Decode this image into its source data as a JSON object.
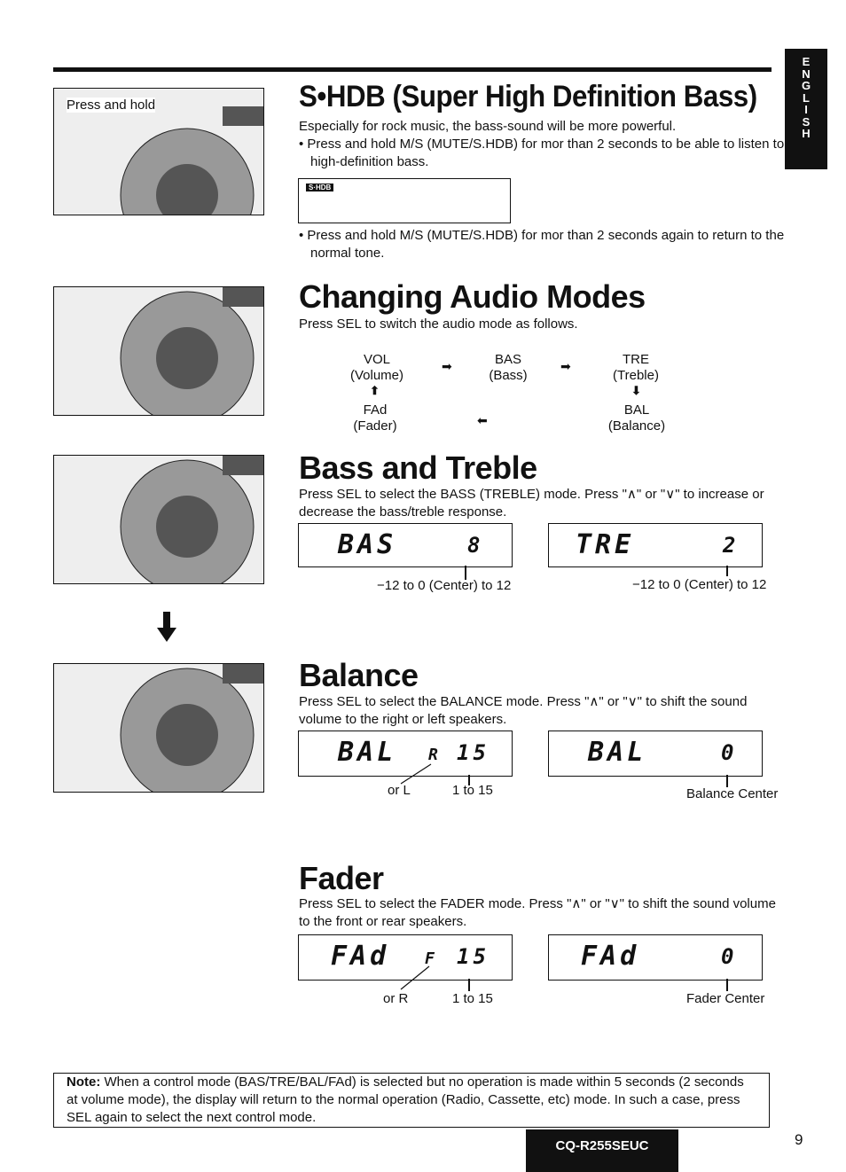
{
  "language_tab": [
    "E",
    "N",
    "G",
    "L",
    "I",
    "S",
    "H"
  ],
  "shdb": {
    "image_caption": "Press and hold",
    "title": "S•HDB (Super High Definition Bass)",
    "intro": "Especially for rock music, the bass-sound will be more powerful.",
    "bullet1": "Press and hold M/S (MUTE/S.HDB) for mor than 2 seconds to be able to listen to high-definition bass.",
    "display_indicator": "S·HDB",
    "bullet2": "Press and hold M/S (MUTE/S.HDB) for mor than 2 seconds again to return to the normal tone."
  },
  "audio_modes": {
    "title": "Changing Audio Modes",
    "intro": "Press SEL to switch the audio mode as follows.",
    "modes": [
      {
        "code": "VOL",
        "name": "(Volume)"
      },
      {
        "code": "BAS",
        "name": "(Bass)"
      },
      {
        "code": "TRE",
        "name": "(Treble)"
      },
      {
        "code": "BAL",
        "name": "(Balance)"
      },
      {
        "code": "FAd",
        "name": "(Fader)"
      }
    ]
  },
  "bass_treble": {
    "title": "Bass and Treble",
    "text": "Press SEL to select the BASS (TREBLE) mode. Press \"∧\" or \"∨\" to increase or decrease the bass/treble response.",
    "display_bass": {
      "label": "BAS",
      "value": "8"
    },
    "display_treble": {
      "label": "TRE",
      "value": "2"
    },
    "range_bass": "−12 to 0 (Center) to 12",
    "range_treble": "−12 to 0 (Center) to 12"
  },
  "balance": {
    "title": "Balance",
    "text": "Press SEL to select the BALANCE mode. Press \"∧\" or \"∨\" to shift the sound volume to the right or left speakers.",
    "display1": {
      "label": "BAL",
      "side": "R",
      "value": "15"
    },
    "display2": {
      "label": "BAL",
      "value": "0"
    },
    "side_note": "or L",
    "range": "1 to 15",
    "center_note": "Balance Center"
  },
  "fader": {
    "title": "Fader",
    "text": "Press SEL to select the FADER mode. Press \"∧\" or \"∨\" to shift the sound volume to the front or rear speakers.",
    "display1": {
      "label": "FAd",
      "side": "F",
      "value": "15"
    },
    "display2": {
      "label": "FAd",
      "value": "0"
    },
    "side_note": "or R",
    "range": "1 to 15",
    "center_note": "Fader Center"
  },
  "note": {
    "label": "Note:",
    "text": " When a control mode (BAS/TRE/BAL/FAd) is selected but no operation is made within 5 seconds (2 seconds at volume mode), the display will return to the normal operation (Radio, Cassette, etc) mode. In such a case, press SEL again to select the next control mode."
  },
  "footer": {
    "model": "CQ-R255SEUC",
    "page": "9"
  }
}
